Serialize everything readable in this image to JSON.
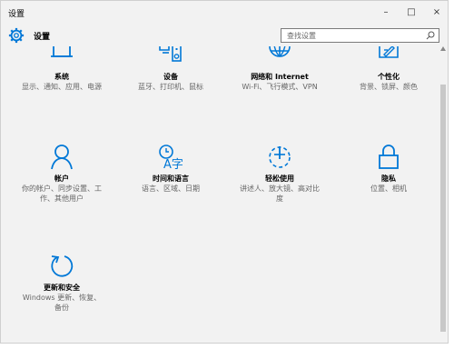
{
  "window": {
    "title": "设置",
    "minimize_glyph": "–",
    "maximize_glyph": "□",
    "close_glyph": "×"
  },
  "header": {
    "app_name": "设置",
    "search_placeholder": "查找设置"
  },
  "colors": {
    "accent": "#0078d7",
    "background": "#f2f2f2",
    "subtext": "#666666"
  },
  "tiles": [
    {
      "title": "系统",
      "subtitle": "显示、通知、应用、电源",
      "icon": "laptop-icon"
    },
    {
      "title": "设备",
      "subtitle": "蓝牙、打印机、鼠标",
      "icon": "devices-icon"
    },
    {
      "title": "网络和 Internet",
      "subtitle": "Wi-Fi、飞行模式、VPN",
      "icon": "globe-icon"
    },
    {
      "title": "个性化",
      "subtitle": "背景、锁屏、颜色",
      "icon": "personalization-icon"
    },
    {
      "title": "帐户",
      "subtitle": "你的帐户、同步设置、工作、其他用户",
      "icon": "person-icon"
    },
    {
      "title": "时间和语言",
      "subtitle": "语言、区域、日期",
      "icon": "time-language-icon"
    },
    {
      "title": "轻松使用",
      "subtitle": "讲述人、放大镜、高对比度",
      "icon": "ease-of-access-icon"
    },
    {
      "title": "隐私",
      "subtitle": "位置、相机",
      "icon": "lock-icon"
    },
    {
      "title": "更新和安全",
      "subtitle": "Windows 更新、恢复、备份",
      "icon": "update-icon"
    }
  ]
}
